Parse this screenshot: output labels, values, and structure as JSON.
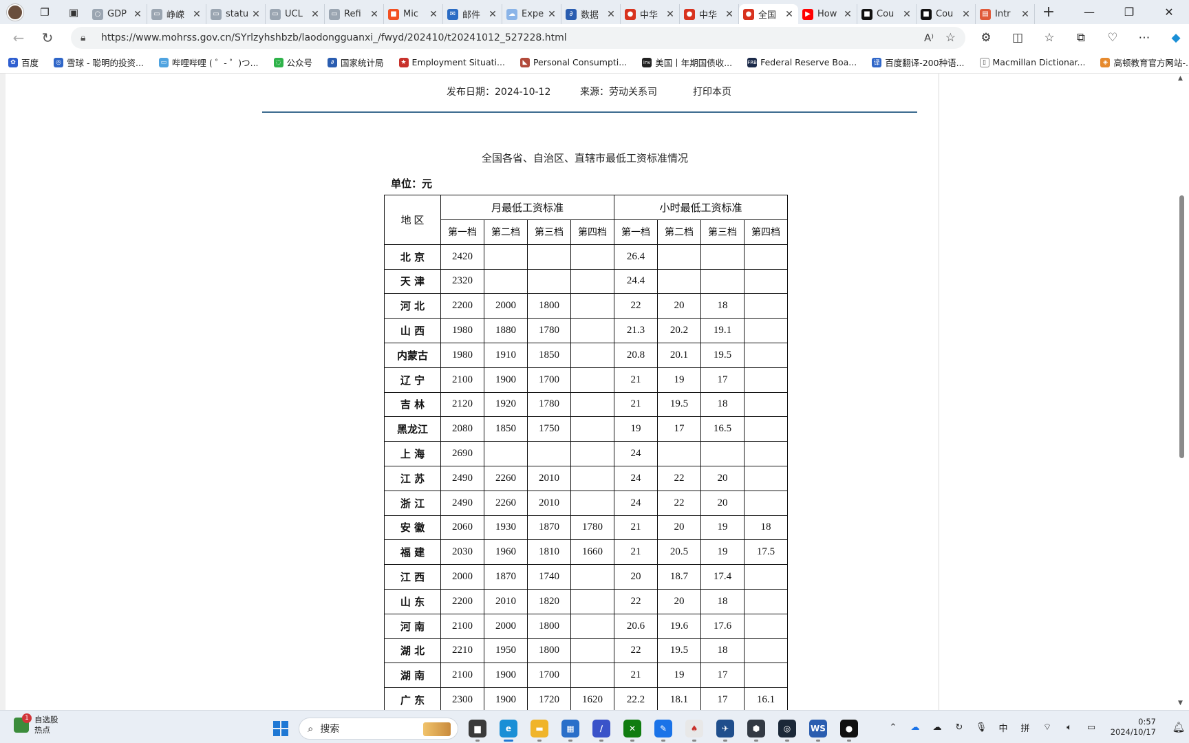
{
  "browser": {
    "tabs": [
      {
        "title": "GDP",
        "color": "#9aa5b1",
        "glyph": "○"
      },
      {
        "title": "峥嵘",
        "color": "#9aa5b1",
        "glyph": "▭"
      },
      {
        "title": "statu",
        "color": "#9aa5b1",
        "glyph": "▭"
      },
      {
        "title": "UCL",
        "color": "#9aa5b1",
        "glyph": "▭"
      },
      {
        "title": "Refi",
        "color": "#9aa5b1",
        "glyph": "▭"
      },
      {
        "title": "Mic",
        "color": "#f25022",
        "glyph": "■"
      },
      {
        "title": "邮件",
        "color": "#2b6cc4",
        "glyph": "✉"
      },
      {
        "title": "Expe",
        "color": "#8ab4e8",
        "glyph": "☁"
      },
      {
        "title": "数据",
        "color": "#2a5db0",
        "glyph": "∂"
      },
      {
        "title": "中华",
        "color": "#d8331f",
        "glyph": "●"
      },
      {
        "title": "中华",
        "color": "#d8331f",
        "glyph": "●"
      },
      {
        "title": "全国",
        "color": "#d8331f",
        "glyph": "●",
        "active": true
      },
      {
        "title": "How",
        "color": "#ff0000",
        "glyph": "▶"
      },
      {
        "title": "Cou",
        "color": "#111111",
        "glyph": "■"
      },
      {
        "title": "Cou",
        "color": "#111111",
        "glyph": "■"
      },
      {
        "title": "Intr",
        "color": "#e05a3a",
        "glyph": "▤"
      }
    ],
    "url": "https://www.mohrss.gov.cn/SYrlzyhshbzb/laodongguanxi_/fwyd/202410/t20241012_527228.html",
    "favorites": [
      {
        "label": "百度",
        "color": "#2f5fd0",
        "glyph": "✿"
      },
      {
        "label": "雪球 - 聪明的投资...",
        "color": "#2f66c8",
        "glyph": "◎"
      },
      {
        "label": "哔哩哔哩 ( ゜- ゜)つ...",
        "color": "#4fa3e0",
        "glyph": "▭"
      },
      {
        "label": "公众号",
        "color": "#2fb34a",
        "glyph": "◌"
      },
      {
        "label": "国家统计局",
        "color": "#2a5db0",
        "glyph": "∂"
      },
      {
        "label": "Employment Situati...",
        "color": "#c8312b",
        "glyph": "★"
      },
      {
        "label": "Personal Consumpti...",
        "color": "#b24a3a",
        "glyph": "◣"
      },
      {
        "label": "美国丨年期国债收...",
        "color": "#222222",
        "glyph": "inv"
      },
      {
        "label": "Federal Reserve Boa...",
        "color": "#1c2b4a",
        "glyph": "FRB"
      },
      {
        "label": "百度翻译-200种语...",
        "color": "#2f66c8",
        "glyph": "译"
      },
      {
        "label": "Macmillan Dictionar...",
        "color": "#ffffff",
        "glyph": "▯"
      },
      {
        "label": "高顿教育官方网站-...",
        "color": "#e68a2e",
        "glyph": "◈"
      }
    ]
  },
  "article": {
    "date_label": "发布日期：2024-10-12",
    "source_label": "来源：劳动关系司",
    "print_label": "打印本页",
    "title": "全国各省、自治区、直辖市最低工资标准情况",
    "unit": "单位：元",
    "table": {
      "region_header": "地 区",
      "monthly_header": "月最低工资标准",
      "hourly_header": "小时最低工资标准",
      "tiers": [
        "第一档",
        "第二档",
        "第三档",
        "第四档"
      ],
      "rows": [
        {
          "name": "北 京",
          "m": [
            "2420",
            "",
            "",
            ""
          ],
          "h": [
            "26.4",
            "",
            "",
            ""
          ]
        },
        {
          "name": "天 津",
          "m": [
            "2320",
            "",
            "",
            ""
          ],
          "h": [
            "24.4",
            "",
            "",
            ""
          ]
        },
        {
          "name": "河 北",
          "m": [
            "2200",
            "2000",
            "1800",
            ""
          ],
          "h": [
            "22",
            "20",
            "18",
            ""
          ]
        },
        {
          "name": "山 西",
          "m": [
            "1980",
            "1880",
            "1780",
            ""
          ],
          "h": [
            "21.3",
            "20.2",
            "19.1",
            ""
          ]
        },
        {
          "name": "内蒙古",
          "m": [
            "1980",
            "1910",
            "1850",
            ""
          ],
          "h": [
            "20.8",
            "20.1",
            "19.5",
            ""
          ]
        },
        {
          "name": "辽 宁",
          "m": [
            "2100",
            "1900",
            "1700",
            ""
          ],
          "h": [
            "21",
            "19",
            "17",
            ""
          ]
        },
        {
          "name": "吉 林",
          "m": [
            "2120",
            "1920",
            "1780",
            ""
          ],
          "h": [
            "21",
            "19.5",
            "18",
            ""
          ]
        },
        {
          "name": "黑龙江",
          "m": [
            "2080",
            "1850",
            "1750",
            ""
          ],
          "h": [
            "19",
            "17",
            "16.5",
            ""
          ]
        },
        {
          "name": "上 海",
          "m": [
            "2690",
            "",
            "",
            ""
          ],
          "h": [
            "24",
            "",
            "",
            ""
          ]
        },
        {
          "name": "江 苏",
          "m": [
            "2490",
            "2260",
            "2010",
            ""
          ],
          "h": [
            "24",
            "22",
            "20",
            ""
          ]
        },
        {
          "name": "浙 江",
          "m": [
            "2490",
            "2260",
            "2010",
            ""
          ],
          "h": [
            "24",
            "22",
            "20",
            ""
          ]
        },
        {
          "name": "安 徽",
          "m": [
            "2060",
            "1930",
            "1870",
            "1780"
          ],
          "h": [
            "21",
            "20",
            "19",
            "18"
          ]
        },
        {
          "name": "福 建",
          "m": [
            "2030",
            "1960",
            "1810",
            "1660"
          ],
          "h": [
            "21",
            "20.5",
            "19",
            "17.5"
          ]
        },
        {
          "name": "江 西",
          "m": [
            "2000",
            "1870",
            "1740",
            ""
          ],
          "h": [
            "20",
            "18.7",
            "17.4",
            ""
          ]
        },
        {
          "name": "山 东",
          "m": [
            "2200",
            "2010",
            "1820",
            ""
          ],
          "h": [
            "22",
            "20",
            "18",
            ""
          ]
        },
        {
          "name": "河 南",
          "m": [
            "2100",
            "2000",
            "1800",
            ""
          ],
          "h": [
            "20.6",
            "19.6",
            "17.6",
            ""
          ]
        },
        {
          "name": "湖 北",
          "m": [
            "2210",
            "1950",
            "1800",
            ""
          ],
          "h": [
            "22",
            "19.5",
            "18",
            ""
          ]
        },
        {
          "name": "湖 南",
          "m": [
            "2100",
            "1900",
            "1700",
            ""
          ],
          "h": [
            "21",
            "19",
            "17",
            ""
          ]
        },
        {
          "name": "广 东",
          "m": [
            "2300",
            "1900",
            "1720",
            "1620"
          ],
          "h": [
            "22.2",
            "18.1",
            "17",
            "16.1"
          ]
        }
      ]
    }
  },
  "taskbar": {
    "weather_title": "自选股",
    "weather_sub": "热点",
    "weather_badge": "1",
    "search_placeholder": "搜索",
    "apps": [
      {
        "name": "file-explorer-gray",
        "color": "#3a3a3a",
        "glyph": "▆"
      },
      {
        "name": "edge",
        "color": "#1a8fd6",
        "glyph": "e",
        "active": true
      },
      {
        "name": "file-explorer",
        "color": "#f0b429",
        "glyph": "▬"
      },
      {
        "name": "store",
        "color": "#2a6fc9",
        "glyph": "▦"
      },
      {
        "name": "mathtype",
        "color": "#3a53c9",
        "glyph": "∕"
      },
      {
        "name": "xbox",
        "color": "#107c10",
        "glyph": "✕"
      },
      {
        "name": "feather",
        "color": "#1a73e8",
        "glyph": "✎"
      },
      {
        "name": "game-red",
        "color": "#e8e8e8",
        "glyph": "♠"
      },
      {
        "name": "plane",
        "color": "#1f4e8c",
        "glyph": "✈"
      },
      {
        "name": "shield",
        "color": "#333a44",
        "glyph": "⬢"
      },
      {
        "name": "steam",
        "color": "#1b2838",
        "glyph": "◎"
      },
      {
        "name": "wps",
        "color": "#2a5db0",
        "glyph": "WS"
      },
      {
        "name": "recorder",
        "color": "#111111",
        "glyph": "●"
      }
    ],
    "ime_lang": "中",
    "ime_mode": "拼",
    "time": "0:57",
    "date": "2024/10/17"
  }
}
